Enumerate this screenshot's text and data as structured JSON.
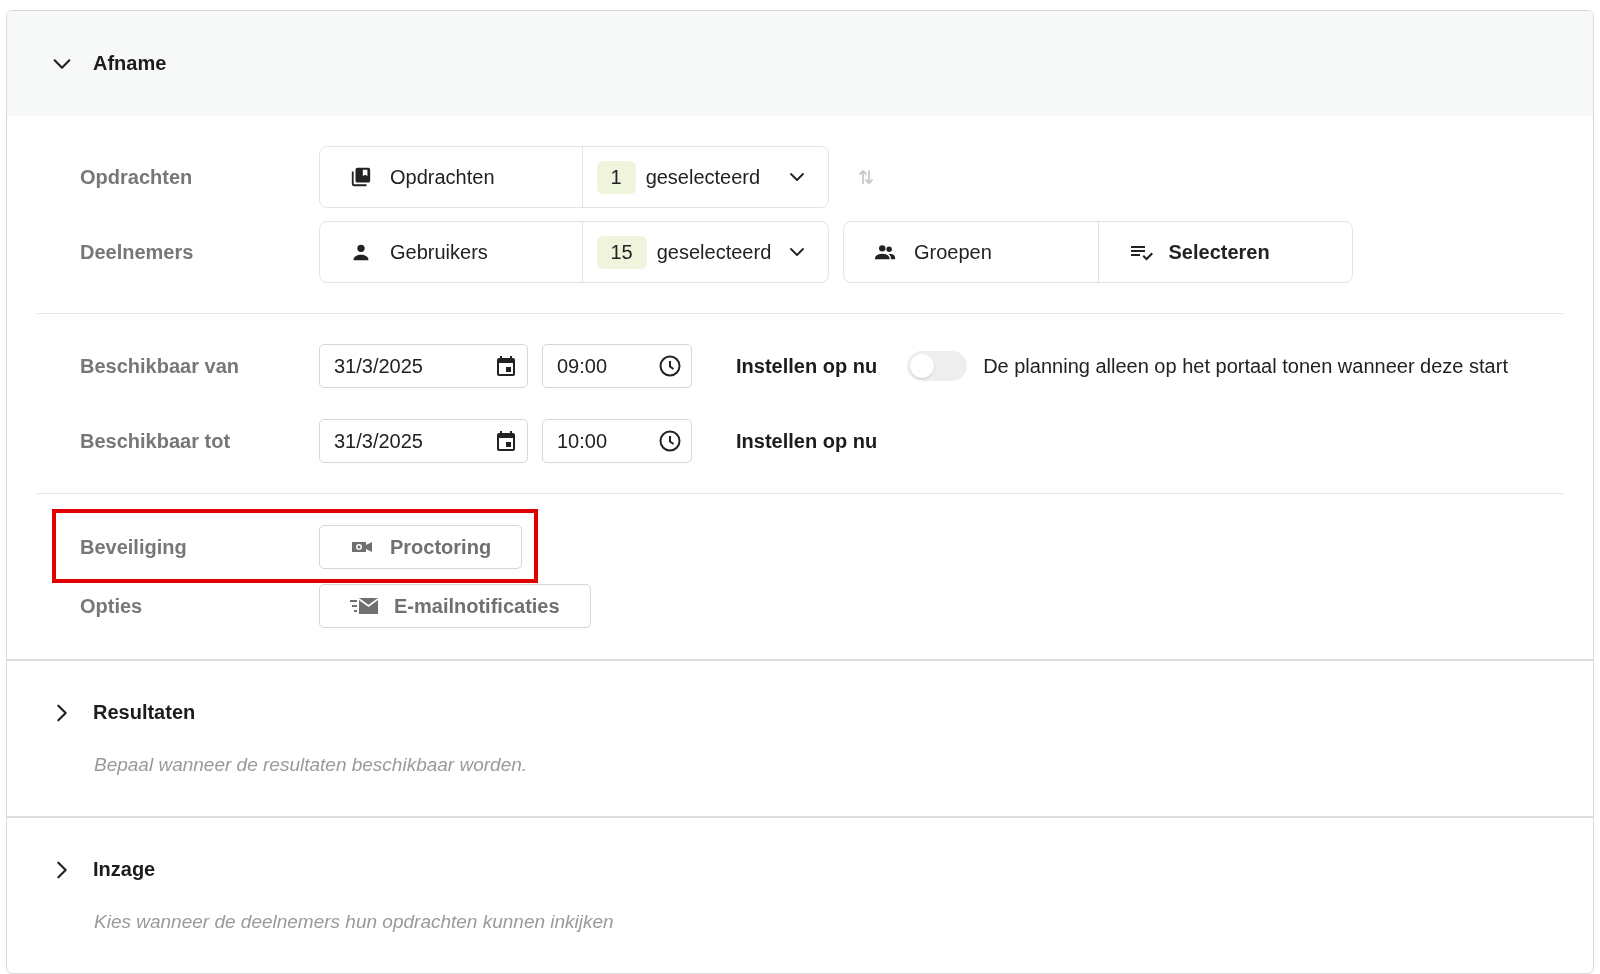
{
  "sections": [
    {
      "title": "Afname",
      "expanded": true,
      "groups": [
        [
          {
            "kind": "selection",
            "label": "Opdrachten",
            "controls": [
              {
                "text": "Opdrachten",
                "count": "1",
                "count_text": "geselecteerd"
              }
            ],
            "sort_disabled": true
          },
          {
            "kind": "selection",
            "label": "Deelnemers",
            "controls": [
              {
                "text": "Gebruikers",
                "count": "15",
                "count_text": "geselecteerd"
              },
              {
                "text": "Groepen",
                "action": "Selecteren"
              }
            ]
          }
        ],
        [
          {
            "kind": "datetime",
            "label": "Beschikbaar van",
            "date": "31/3/2025",
            "time": "09:00",
            "now_link": "Instellen op nu",
            "toggle": {
              "on": false,
              "label": "De planning alleen op het portaal tonen wanneer deze start"
            }
          },
          {
            "kind": "datetime",
            "label": "Beschikbaar tot",
            "date": "31/3/2025",
            "time": "10:00",
            "now_link": "Instellen op nu"
          }
        ],
        [
          {
            "kind": "button",
            "label": "Beveiliging",
            "highlighted": true,
            "text": "Proctoring"
          },
          {
            "kind": "button",
            "label": "Opties",
            "text": "E-mailnotificaties"
          }
        ]
      ]
    },
    {
      "title": "Resultaten",
      "expanded": false,
      "description": "Bepaal wanneer de resultaten beschikbaar worden."
    },
    {
      "title": "Inzage",
      "expanded": false,
      "description": "Kies wanneer de deelnemers hun opdrachten kunnen inkijken"
    }
  ]
}
